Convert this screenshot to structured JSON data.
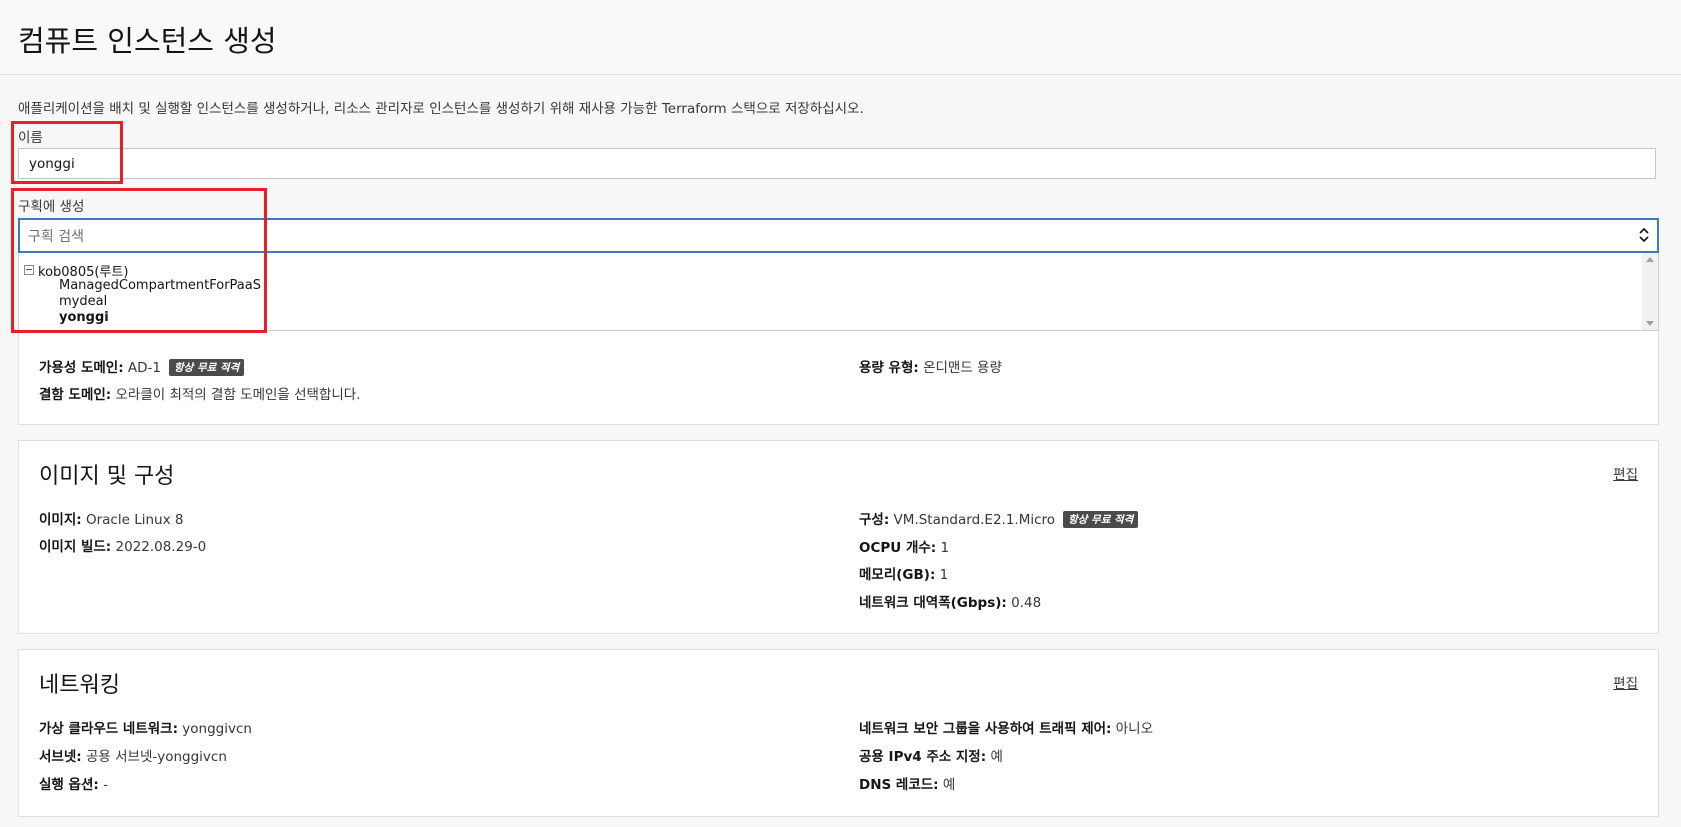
{
  "page": {
    "title": "컴퓨트 인스턴스 생성",
    "description": "애플리케이션을 배치 및 실행할 인스턴스를 생성하거나, 리소스 관리자로 인스턴스를 생성하기 위해 재사용 가능한 Terraform 스택으로 저장하십시오."
  },
  "name_field": {
    "label": "이름",
    "value": "yonggi"
  },
  "compartment": {
    "label": "구획에 생성",
    "placeholder": "구획 검색",
    "tree": {
      "root": "kob0805(루트)",
      "children": [
        "ManagedCompartmentForPaaS",
        "mydeal",
        "yonggi"
      ],
      "selected": "yonggi"
    }
  },
  "placement": {
    "availability_domain": {
      "key": "가용성 도메인:",
      "value": "AD-1",
      "badge": "항상 무료 적격"
    },
    "fault_domain": {
      "key": "결함 도메인:",
      "value": "오라클이 최적의 결함 도메인을 선택합니다."
    },
    "capacity_type": {
      "key": "용량 유형:",
      "value": "온디맨드 용량"
    }
  },
  "image_section": {
    "title": "이미지 및 구성",
    "edit_label": "편집",
    "image": {
      "key": "이미지:",
      "value": "Oracle Linux 8"
    },
    "image_build": {
      "key": "이미지 빌드:",
      "value": "2022.08.29-0"
    },
    "shape": {
      "key": "구성:",
      "value": "VM.Standard.E2.1.Micro",
      "badge": "항상 무료 적격"
    },
    "ocpu": {
      "key": "OCPU 개수:",
      "value": "1"
    },
    "memory": {
      "key": "메모리(GB):",
      "value": "1"
    },
    "bandwidth": {
      "key": "네트워크 대역폭(Gbps):",
      "value": "0.48"
    }
  },
  "network_section": {
    "title": "네트워킹",
    "edit_label": "편집",
    "vcn": {
      "key": "가상 클라우드 네트워크:",
      "value": "yonggivcn"
    },
    "subnet": {
      "key": "서브넷:",
      "value": "공용 서브넷-yonggivcn"
    },
    "launch_options": {
      "key": "실행 옵션:",
      "value": "-"
    },
    "nsg": {
      "key": "네트워크 보안 그룹을 사용하여 트래픽 제어:",
      "value": "아니오"
    },
    "public_ip": {
      "key": "공용 IPv4 주소 지정:",
      "value": "예"
    },
    "dns": {
      "key": "DNS 레코드:",
      "value": "예"
    }
  },
  "colors": {
    "highlight_box": "#e5202e",
    "focus_border": "#3b79c1",
    "badge_bg": "#4b4b4b"
  }
}
